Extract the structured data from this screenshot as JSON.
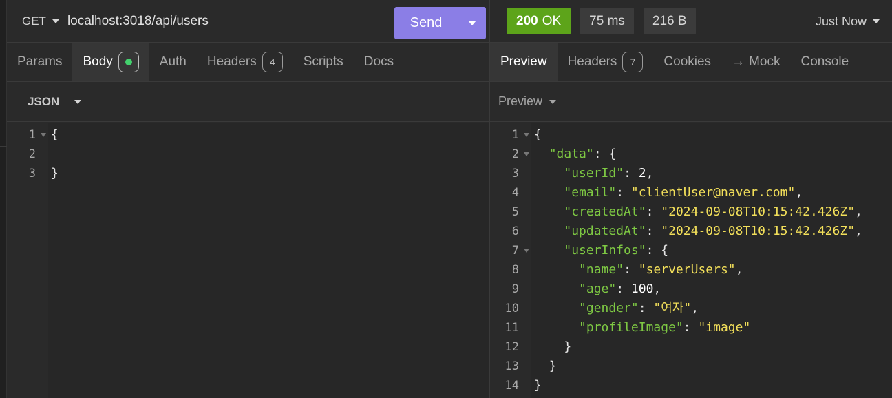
{
  "request": {
    "method": "GET",
    "url": "localhost:3018/api/users",
    "send_label": "Send",
    "tabs": [
      {
        "label": "Params"
      },
      {
        "label": "Body"
      },
      {
        "label": "Auth"
      },
      {
        "label": "Headers",
        "badge": "4"
      },
      {
        "label": "Scripts"
      },
      {
        "label": "Docs"
      }
    ],
    "active_tab": "Body",
    "body_mode": "JSON",
    "editor_lines": [
      {
        "num": "1",
        "text": "{"
      },
      {
        "num": "2",
        "text": ""
      },
      {
        "num": "3",
        "text": "}"
      }
    ]
  },
  "response": {
    "status_code": "200",
    "status_text": "OK",
    "time": "75 ms",
    "size": "216 B",
    "timestamp": "Just Now",
    "tabs": [
      {
        "label": "Preview"
      },
      {
        "label": "Headers",
        "badge": "7"
      },
      {
        "label": "Cookies"
      },
      {
        "label": "Mock",
        "arrow": "→"
      },
      {
        "label": "Console"
      }
    ],
    "active_tab": "Preview",
    "preview_mode": "Preview",
    "line_numbers": [
      "1",
      "2",
      "3",
      "4",
      "5",
      "6",
      "7",
      "8",
      "9",
      "10",
      "11",
      "12",
      "13",
      "14"
    ],
    "json_lines": [
      {
        "indent": "",
        "key": "",
        "sep": "",
        "val": "",
        "punct": "{"
      },
      {
        "indent": "  ",
        "key": "\"data\"",
        "sep": ": ",
        "val": "",
        "punct": "{"
      },
      {
        "indent": "    ",
        "key": "\"userId\"",
        "sep": ": ",
        "val": "2",
        "punct": ","
      },
      {
        "indent": "    ",
        "key": "\"email\"",
        "sep": ": ",
        "val": "\"clientUser@naver.com\"",
        "punct": ","
      },
      {
        "indent": "    ",
        "key": "\"createdAt\"",
        "sep": ": ",
        "val": "\"2024-09-08T10:15:42.426Z\"",
        "punct": ","
      },
      {
        "indent": "    ",
        "key": "\"updatedAt\"",
        "sep": ": ",
        "val": "\"2024-09-08T10:15:42.426Z\"",
        "punct": ","
      },
      {
        "indent": "    ",
        "key": "\"userInfos\"",
        "sep": ": ",
        "val": "",
        "punct": "{"
      },
      {
        "indent": "      ",
        "key": "\"name\"",
        "sep": ": ",
        "val": "\"serverUsers\"",
        "punct": ","
      },
      {
        "indent": "      ",
        "key": "\"age\"",
        "sep": ": ",
        "val": "100",
        "punct": ","
      },
      {
        "indent": "      ",
        "key": "\"gender\"",
        "sep": ": ",
        "val": "\"여자\"",
        "punct": ","
      },
      {
        "indent": "      ",
        "key": "\"profileImage\"",
        "sep": ": ",
        "val": "\"image\"",
        "punct": ""
      },
      {
        "indent": "    ",
        "key": "",
        "sep": "",
        "val": "",
        "punct": "}"
      },
      {
        "indent": "  ",
        "key": "",
        "sep": "",
        "val": "",
        "punct": "}"
      },
      {
        "indent": "",
        "key": "",
        "sep": "",
        "val": "",
        "punct": "}"
      }
    ]
  },
  "icons": {
    "method_dropdown": "chevron-down-icon",
    "send_dropdown": "chevron-down-icon",
    "body_status": "green-dot-icon",
    "timestamp_dropdown": "chevron-down-icon",
    "fold": "fold-triangle-icon"
  },
  "colors": {
    "send_button": "#8b7ee6",
    "status_ok": "#5da41a",
    "json_key": "#7ec843",
    "json_string": "#f2df5a",
    "body_dot": "#43d16d"
  }
}
